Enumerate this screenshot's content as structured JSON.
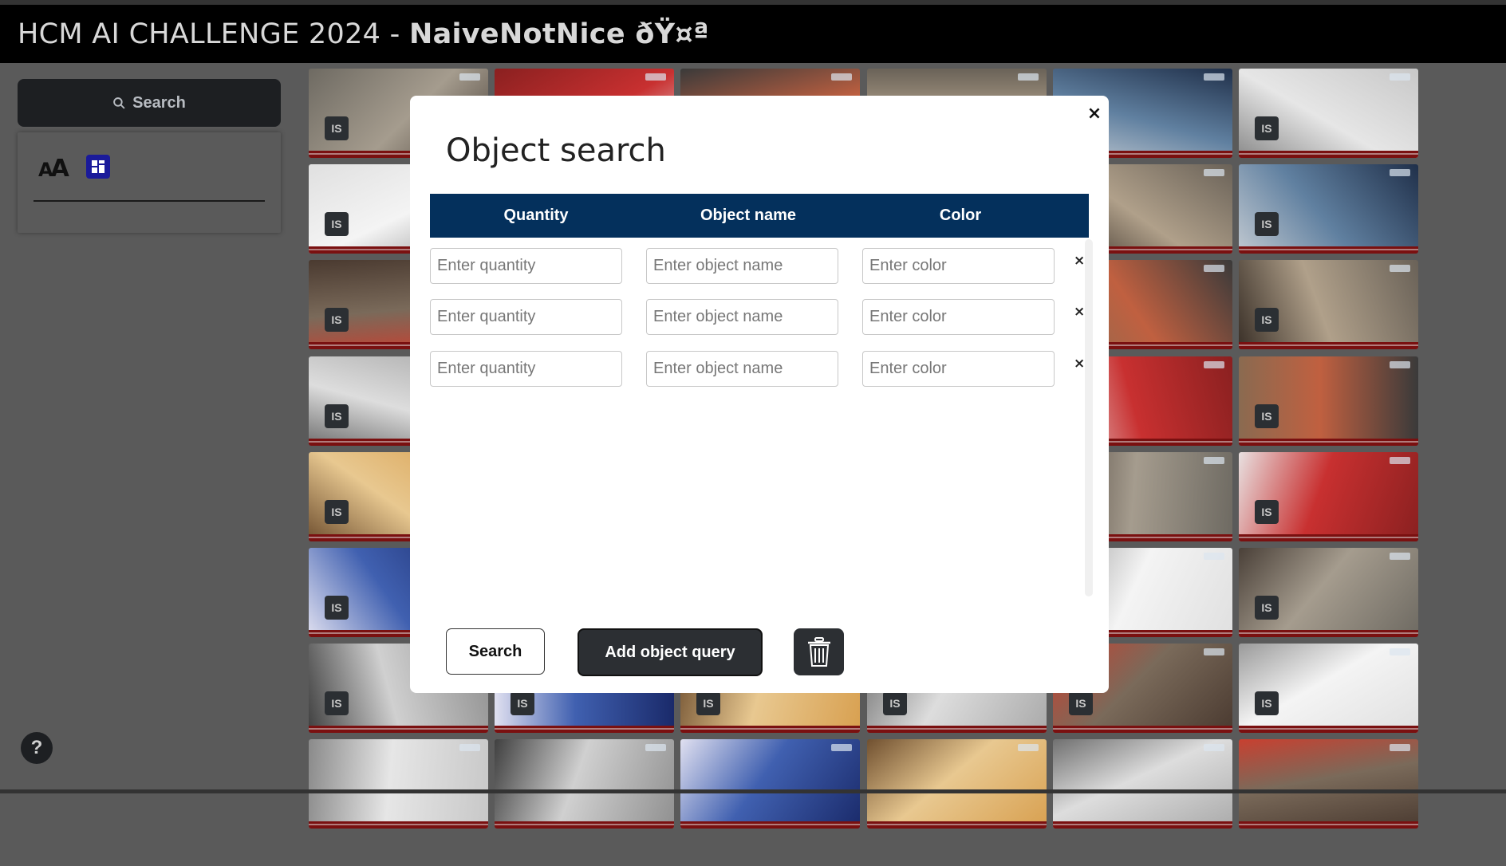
{
  "header": {
    "title": "HCM AI CHALLENGE 2024 - ",
    "team": "NaiveNotNice ðŸ¤ª"
  },
  "sidebar": {
    "search_label": "Search",
    "font_icon": "font-size-icon",
    "layout_icon": "layout-icon"
  },
  "help": {
    "label": "?"
  },
  "grid": {
    "badge_label": "IS"
  },
  "modal": {
    "title": "Object search",
    "close_label": "×",
    "columns": [
      "Quantity",
      "Object name",
      "Color"
    ],
    "placeholders": {
      "quantity": "Enter quantity",
      "object_name": "Enter object name",
      "color": "Enter color"
    },
    "rows": [
      {
        "quantity": "",
        "object_name": "",
        "color": ""
      },
      {
        "quantity": "",
        "object_name": "",
        "color": ""
      },
      {
        "quantity": "",
        "object_name": "",
        "color": ""
      }
    ],
    "remove_label": "×",
    "buttons": {
      "search": "Search",
      "add": "Add object query",
      "clear_icon": "trash-icon"
    }
  },
  "colors": {
    "header_bg": "#000000",
    "table_head": "#04305c",
    "dark_button": "#2c2f33",
    "overlay": "#5a5a5a"
  }
}
